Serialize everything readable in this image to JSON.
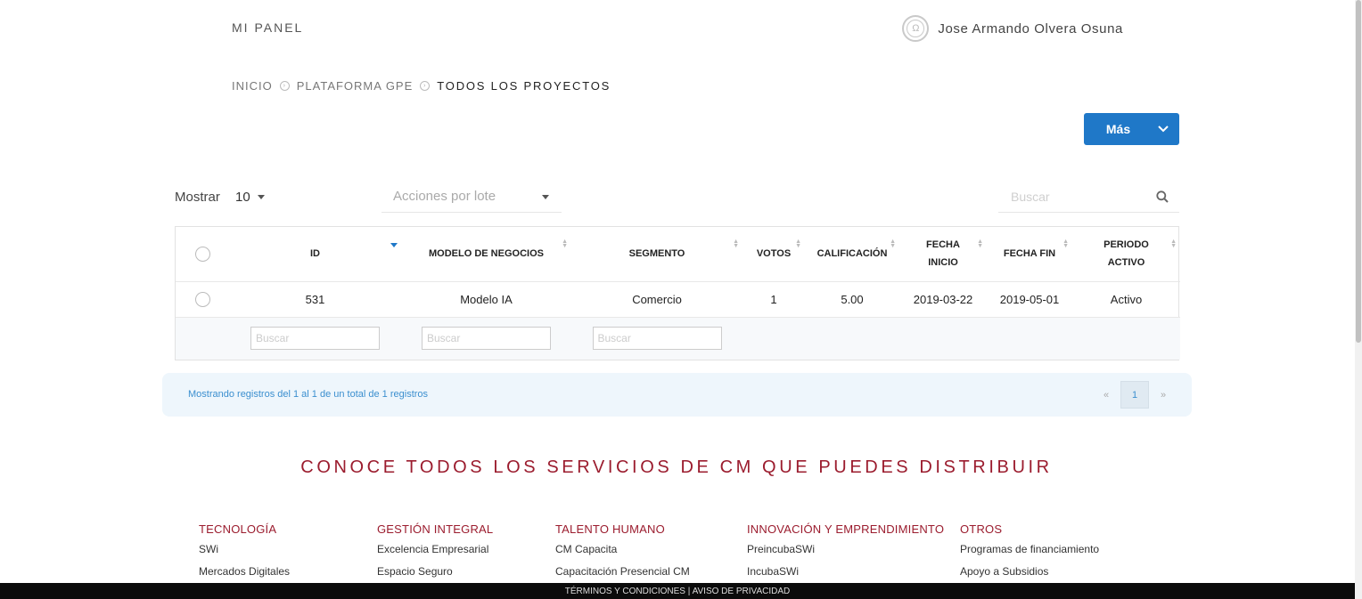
{
  "header": {
    "title": "MI PANEL",
    "user_name": "Jose Armando Olvera Osuna"
  },
  "breadcrumb": {
    "items": [
      "INICIO",
      "PLATAFORMA GPE",
      "TODOS LOS PROYECTOS"
    ]
  },
  "actions": {
    "more_button": "Más"
  },
  "controls": {
    "show_label": "Mostrar",
    "show_value": "10",
    "batch_actions_placeholder": "Acciones por lote",
    "search_placeholder": "Buscar"
  },
  "table": {
    "columns": [
      "ID",
      "MODELO DE NEGOCIOS",
      "SEGMENTO",
      "VOTOS",
      "CALIFICACIÓN",
      "FECHA INICIO",
      "FECHA FIN",
      "PERIODO ACTIVO"
    ],
    "column_lines": {
      "fecha_inicio": [
        "FECHA",
        "INICIO"
      ],
      "periodo_activo": [
        "PERIODO",
        "ACTIVO"
      ]
    },
    "rows": [
      {
        "id": "531",
        "modelo": "Modelo IA",
        "segmento": "Comercio",
        "votos": "1",
        "calificacion": "5.00",
        "fecha_inicio": "2019-03-22",
        "fecha_fin": "2019-05-01",
        "periodo": "Activo"
      }
    ],
    "filter_placeholder": "Buscar"
  },
  "pagination": {
    "info": "Mostrando registros del 1 al 1 de un total de 1 registros",
    "prev": "«",
    "current": "1",
    "next": "»"
  },
  "services": {
    "title": "CONOCE TODOS LOS SERVICIOS DE CM QUE PUEDES DISTRIBUIR",
    "columns": [
      {
        "heading": "TECNOLOGÍA",
        "links": [
          "SWi",
          "Mercados Digitales"
        ]
      },
      {
        "heading": "GESTIÓN INTEGRAL",
        "links": [
          "Excelencia Empresarial",
          "Espacio Seguro"
        ]
      },
      {
        "heading": "TALENTO HUMANO",
        "links": [
          "CM Capacita",
          "Capacitación Presencial CM"
        ]
      },
      {
        "heading": "INNOVACIÓN Y EMPRENDIMIENTO",
        "links": [
          "PreincubaSWi",
          "IncubaSWi"
        ]
      },
      {
        "heading": "OTROS",
        "links": [
          "Programas de financiamiento",
          "Apoyo a Subsidios"
        ]
      }
    ]
  },
  "footer": {
    "terms": "TÉRMINOS Y CONDICIONES",
    "separator": " | ",
    "privacy": "AVISO DE PRIVACIDAD"
  },
  "colors": {
    "primary": "#1f78c8",
    "brand_red": "#9b1c2e",
    "info_bg": "#eef6fc",
    "info_text": "#3b8fcf"
  },
  "icons": {
    "user": "user-circle-icon",
    "breadcrumb_sep": "chevron-circle-icon",
    "dropdown": "caret-down-icon",
    "search": "search-icon"
  }
}
